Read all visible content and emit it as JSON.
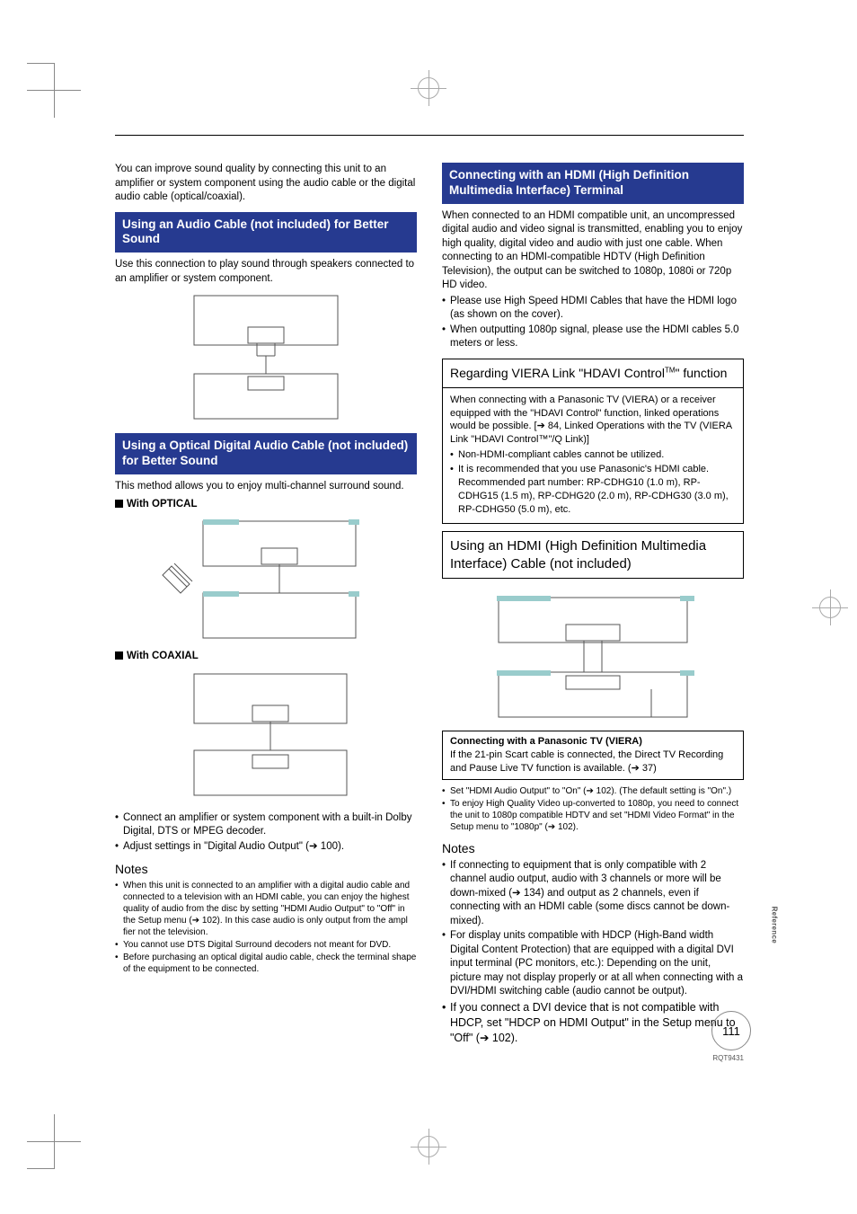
{
  "left": {
    "intro": "You can improve sound quality by connecting this unit to an amplifier or system component using the audio cable or the digital audio cable (optical/coaxial).",
    "h1": "Using an Audio Cable (not included) for Better Sound",
    "p1": "Use this connection to play sound through speakers connected to an amplifier or system component.",
    "h2": "Using a Optical Digital Audio Cable (not included) for Better Sound",
    "p2": "This method allows you to enjoy multi-channel surround sound.",
    "opt_label": "With OPTICAL",
    "coax_label": "With COAXIAL",
    "bul1": "Connect an amplifier or system component with a built-in Dolby Digital, DTS or MPEG decoder.",
    "bul2": "Adjust settings in \"Digital Audio Output\" (➔ 100).",
    "notes_h": "Notes",
    "n1": "When this unit is connected to an amplifier with a digital audio cable and connected to a television with an HDMI cable, you can enjoy the highest quality of audio from the disc by setting \"HDMI Audio Output\" to \"Off\" in the Setup menu (➔ 102). In this case audio is only output from the ampl fier not the television.",
    "n2": "You cannot use DTS Digital Surround decoders not meant for DVD.",
    "n3": "Before purchasing an optical digital audio cable, check the terminal shape of the equipment to be connected."
  },
  "right": {
    "h1": "Connecting with an HDMI (High Definition Multimedia Interface) Terminal",
    "p1": "When connected to an HDMI compatible unit, an uncompressed digital audio and video signal is transmitted, enabling you to enjoy high quality, digital video and audio with just one cable. When connecting to an HDMI-compatible HDTV (High Definition Television), the output can be switched to 1080p, 1080i or 720p HD video.",
    "pb1": "Please use High Speed HDMI Cables that have the HDMI logo (as shown on the cover).",
    "pb2": "When outputting 1080p signal, please use the HDMI cables 5.0 meters or less.",
    "box1_title_a": "Regarding VIERA Link \"HDAVI Control",
    "box1_title_b": "\" function",
    "box1_p": "When connecting with a Panasonic TV (VIERA) or a receiver equipped with the \"HDAVI Control\" function, linked operations would be possible. [➔ 84, Linked Operations with the TV (VIERA Link \"HDAVI Control™\"/Q Link)]",
    "box1_b1": "Non-HDMI-compliant cables cannot be utilized.",
    "box1_b2": "It is recommended that you use Panasonic's HDMI cable. Recommended part number: RP-CDHG10 (1.0 m), RP-CDHG15 (1.5 m), RP-CDHG20 (2.0 m), RP-CDHG30 (3.0 m), RP-CDHG50 (5.0 m), etc.",
    "box2_title": "Using an HDMI (High Definition Multimedia Interface) Cable (not included)",
    "box2_sub_h": "Connecting with a Panasonic TV (VIERA)",
    "box2_sub_p": "If the 21-pin Scart cable is connected, the Direct TV Recording and Pause Live TV function is available. (➔ 37)",
    "after_b1": "Set \"HDMI Audio Output\" to \"On\" (➔ 102). (The default setting is \"On\".)",
    "after_b2": "To enjoy High Quality Video up-converted to 1080p, you need to connect the unit to 1080p compatible HDTV and set \"HDMI Video Format\" in the Setup menu to \"1080p\" (➔ 102).",
    "notes_h": "Notes",
    "n1": "If connecting to equipment that is only compatible with 2 channel audio output, audio with 3 channels or more will be down-mixed (➔ 134) and output as 2 channels, even if connecting with an HDMI cable (some discs cannot be down-mixed).",
    "n2": "For display units compatible with HDCP (High-Band width Digital Content Protection) that are equipped with a digital DVI input terminal (PC monitors, etc.): Depending on the unit, picture may not display properly or at all when connecting with a DVI/HDMI switching cable (audio cannot be output).",
    "n3": "If you connect a DVI device that is not compatible with HDCP, set \"HDCP on HDMI Output\" in the Setup menu to \"Off\" (➔ 102)."
  },
  "side_tab": "Reference",
  "page_num": "111",
  "footer": "RQT9431",
  "tm": "TM"
}
